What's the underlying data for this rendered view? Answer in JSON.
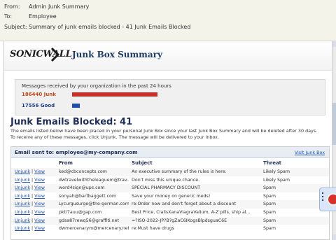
{
  "email": {
    "from_label": "From:",
    "from_value": "Admin Junk Summary",
    "to_label": "To:",
    "to_value": "Employee",
    "subject_label": "Subject:",
    "subject_value": "Summary of junk emails blocked - 41 Junk Emails Blocked"
  },
  "brand": {
    "logo": "SONICWALL",
    "title": "Junk Box Summary"
  },
  "stats": {
    "caption": "Messages received by your organization in the past 24 hours",
    "junk": {
      "label": "186440 Junk",
      "value": 186440,
      "color": "#c42f2a"
    },
    "good": {
      "label": "17556 Good",
      "value": 17556,
      "color": "#1f4fa8"
    }
  },
  "heading": "Junk Emails Blocked: 41",
  "desc_line1": "The emails listed below have been placed in your personal Junk Box since your last Junk Box Summary and will be deleted after 30 days.",
  "desc_line2": "To receive any of these messages, click Unjunk. The message will be delivered to your inbox.",
  "table": {
    "sent_to": "Email sent to: employee@my-company.com",
    "visit_link": "Visit Junk Box",
    "col_from": "From",
    "col_subject": "Subject",
    "col_threat": "Threat",
    "unjunk_label": "Unjunk",
    "sep": "|",
    "view_label": "View",
    "rows": [
      {
        "from": "ked@cbconcepts.com",
        "subject": "An executive summary of the rules is here.",
        "threat": "Likely Spam"
      },
      {
        "from": "dwtravelwiththeleaguem@trav...",
        "subject": "Don't miss this unique chance.",
        "threat": "Likely Spam"
      },
      {
        "from": "word4sign@ups.com",
        "subject": "SPECIAL PHARMACY DISCOUNT",
        "threat": "Spam"
      },
      {
        "from": "sonyah@bartbaggett.com",
        "subject": "Save your money on generic meds!",
        "threat": "Spam"
      },
      {
        "from": "Lycurgusurge@the-german.com",
        "subject": "re:Order now and don't forget about a discount",
        "threat": "Spam"
      },
      {
        "from": "pkti7auu@gap.com",
        "subject": "Best Price, CialisXanaViagraValium, A-Z pills, ship al...",
        "threat": "Spam"
      },
      {
        "from": "gdsa87rewq56@graffiti.net",
        "subject": "=?ISO-2022-JP?B?gZaC6IKogsBlpdsguaC6E",
        "threat": "Spam"
      },
      {
        "from": "dwmercenarym@mercenary.net",
        "subject": "re:Must have drugs",
        "threat": "Spam"
      }
    ]
  },
  "icons": {
    "logo_chevron": "chevron-right-icon",
    "widget": "notification-badge-icon"
  }
}
